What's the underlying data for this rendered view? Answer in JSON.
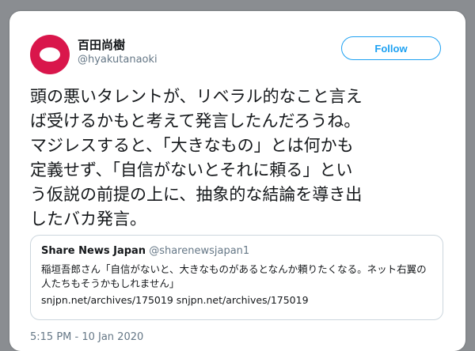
{
  "tweet": {
    "author_name": "百田尚樹",
    "author_handle": "@hyakutanaoki",
    "follow_label": "Follow",
    "text": "頭の悪いタレントが、リベラル的なこと言え\nば受けるかもと考えて発言したんだろうね。\nマジレスすると、「大きなもの」とは何かも\n定義せず、「自信がないとそれに頼る」とい\nう仮説の前提の上に、抽象的な結論を導き出\nしたバカ発言。",
    "timestamp": "5:15 PM - 10 Jan 2020"
  },
  "quote": {
    "author_name": "Share News Japan",
    "author_handle": "@sharenewsjapan1",
    "text": "稲垣吾郎さん「自信がないと、大きなものがあるとなんか頼りたくなる。ネット右翼の人たちもそうかもしれません」",
    "links": "snjpn.net/archives/175019 snjpn.net/archives/175019"
  },
  "colors": {
    "accent": "#1da1f2",
    "avatar": "#d9164b",
    "secondary_text": "#657786"
  }
}
